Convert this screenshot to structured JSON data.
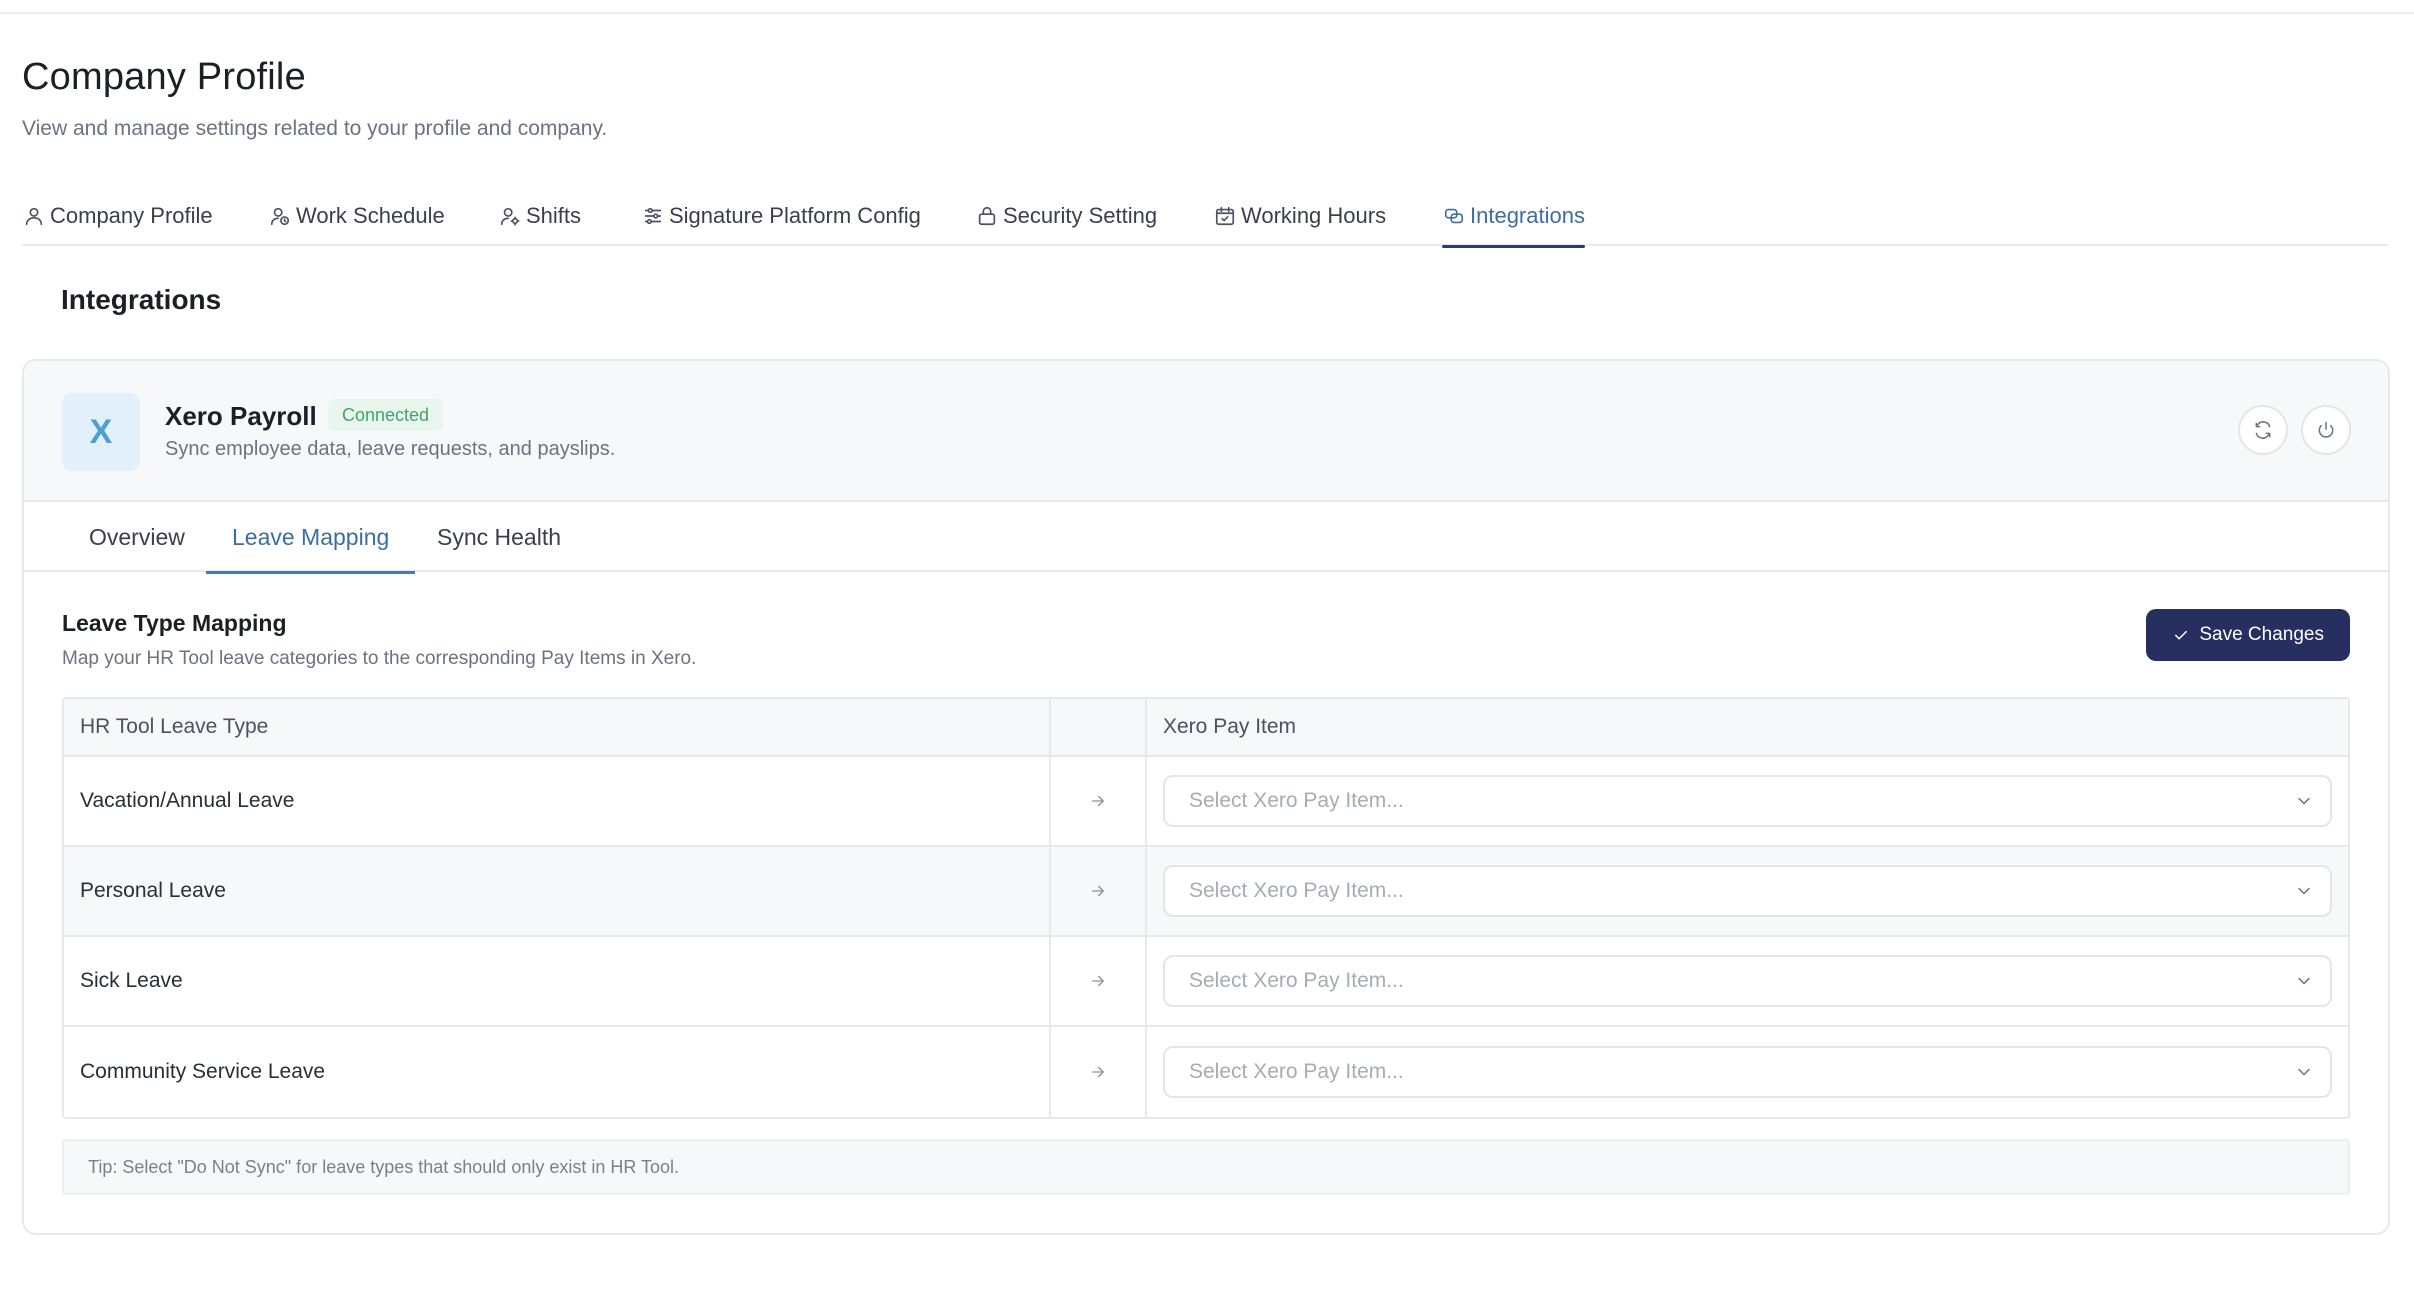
{
  "page": {
    "title": "Company Profile",
    "subtitle": "View and manage settings related to your profile and company."
  },
  "main_tabs": [
    {
      "label": "Company Profile",
      "icon": "user-icon",
      "active": false
    },
    {
      "label": "Work Schedule",
      "icon": "user-clock-icon",
      "active": false
    },
    {
      "label": "Shifts",
      "icon": "user-cog-icon",
      "active": false
    },
    {
      "label": "Signature Platform Config",
      "icon": "sliders-icon",
      "active": false
    },
    {
      "label": "Security Setting",
      "icon": "lock-icon",
      "active": false
    },
    {
      "label": "Working Hours",
      "icon": "calendar-check-icon",
      "active": false
    },
    {
      "label": "Integrations",
      "icon": "link-icon",
      "active": true
    }
  ],
  "section_title": "Integrations",
  "integration": {
    "logo_letter": "X",
    "name": "Xero Payroll",
    "status": "Connected",
    "description": "Sync employee data, leave requests, and payslips.",
    "actions": [
      {
        "name": "refresh",
        "icon": "refresh-icon"
      },
      {
        "name": "disconnect",
        "icon": "power-icon"
      }
    ]
  },
  "sub_tabs": [
    {
      "label": "Overview",
      "active": false
    },
    {
      "label": "Leave Mapping",
      "active": true
    },
    {
      "label": "Sync Health",
      "active": false
    }
  ],
  "mapping": {
    "title": "Leave Type Mapping",
    "subtitle": "Map your HR Tool leave categories to the corresponding Pay Items in Xero.",
    "save_label": "Save Changes",
    "columns": [
      "HR Tool Leave Type",
      "",
      "Xero Pay Item"
    ],
    "rows": [
      {
        "leave_type": "Vacation/Annual Leave",
        "pay_item_placeholder": "Select Xero Pay Item..."
      },
      {
        "leave_type": "Personal Leave",
        "pay_item_placeholder": "Select Xero Pay Item..."
      },
      {
        "leave_type": "Sick Leave",
        "pay_item_placeholder": "Select Xero Pay Item..."
      },
      {
        "leave_type": "Community Service Leave",
        "pay_item_placeholder": "Select Xero Pay Item..."
      }
    ],
    "tip": "Tip: Select \"Do Not Sync\" for leave types that should only exist in HR Tool."
  },
  "colors": {
    "accent": "#3c6e9f",
    "primary_button": "#262f5f",
    "connected_badge_bg": "#e8f6ee",
    "connected_badge_text": "#3fa46a",
    "logo_bg": "#e1f0fa",
    "logo_text": "#4f9fd6"
  }
}
